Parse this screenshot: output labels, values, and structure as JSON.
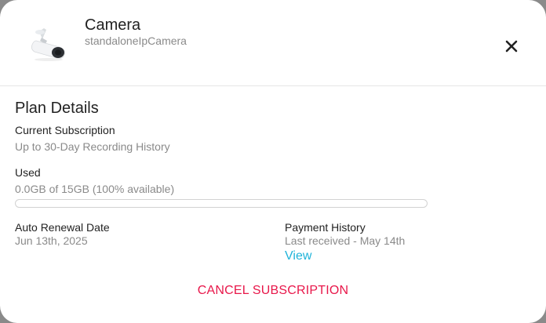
{
  "device": {
    "title": "Camera",
    "subtitle": "standaloneIpCamera",
    "icon": "camera-icon"
  },
  "close_icon": "close-icon",
  "plan": {
    "section_title": "Plan Details",
    "current_subscription_label": "Current Subscription",
    "current_subscription_value": "Up to 30-Day Recording History",
    "used_label": "Used",
    "used_value": "0.0GB of 15GB (100% available)",
    "used_fraction": 0.0,
    "auto_renewal_label": "Auto Renewal Date",
    "auto_renewal_value": "Jun 13th, 2025",
    "payment_history_label": "Payment History",
    "payment_history_value": "Last received - May 14th",
    "view_link": "View"
  },
  "cancel_label": "CANCEL SUBSCRIPTION",
  "colors": {
    "accent": "#1fb3d9",
    "danger": "#e8174a"
  }
}
